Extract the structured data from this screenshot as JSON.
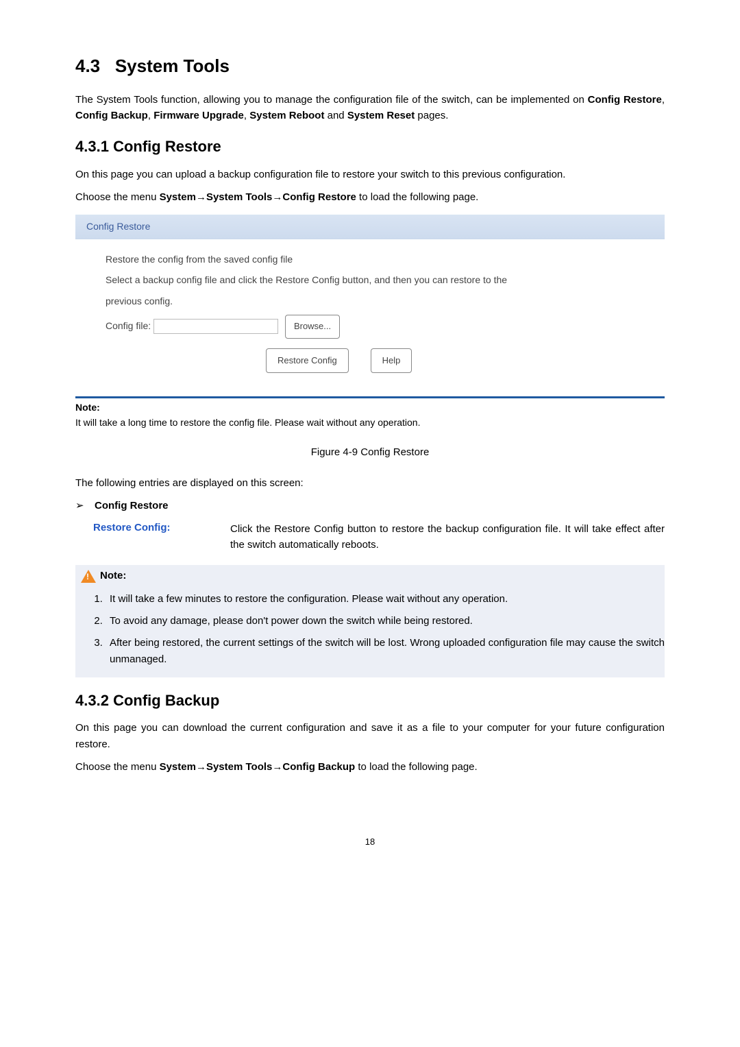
{
  "section": {
    "number": "4.3",
    "title": "System Tools",
    "intro_pre": "The System Tools function, allowing you to manage the configuration file of the switch, can be implemented on ",
    "intro_bold": [
      "Config Restore",
      "Config Backup",
      "Firmware Upgrade",
      "System Reboot",
      "System Reset"
    ],
    "intro_post": " pages."
  },
  "sub1": {
    "number": "4.3.1",
    "title": "Config Restore",
    "desc": "On this page you can upload a backup configuration file to restore your switch to this previous configuration.",
    "menu_pre": "Choose the menu ",
    "menu_path": [
      "System",
      "System Tools",
      "Config Restore"
    ],
    "menu_post": " to load the following page."
  },
  "panel": {
    "header": "Config Restore",
    "line1": "Restore the config from the saved config file",
    "line2": "Select a backup config file and click the Restore Config button, and then you can restore to the",
    "line3": "previous config.",
    "file_label": "Config file:",
    "browse": "Browse...",
    "restore_btn": "Restore Config",
    "help_btn": "Help",
    "note_label": "Note:",
    "note_text": "It will take a long time to restore the config file. Please wait without any operation."
  },
  "caption": "Figure 4-9 Config Restore",
  "entries_intro": "The following entries are displayed on this screen:",
  "bullet_label": "Config Restore",
  "def": {
    "term": "Restore Config:",
    "text": "Click the Restore Config button to restore the backup configuration file. It will take effect after the switch automatically reboots."
  },
  "notebox": {
    "title": "Note:",
    "items": [
      "It will take a few minutes to restore the configuration. Please wait without any operation.",
      "To avoid any damage, please don't power down the switch while being restored.",
      "After being restored, the current settings of the switch will be lost. Wrong uploaded configuration file may cause the switch unmanaged."
    ]
  },
  "sub2": {
    "number": "4.3.2",
    "title": "Config Backup",
    "desc": "On this page you can download the current configuration and save it as a file to your computer for your future configuration restore.",
    "menu_pre": "Choose the menu ",
    "menu_path": [
      "System",
      "System Tools",
      "Config Backup"
    ],
    "menu_post": " to load the following page."
  },
  "page_number": "18"
}
